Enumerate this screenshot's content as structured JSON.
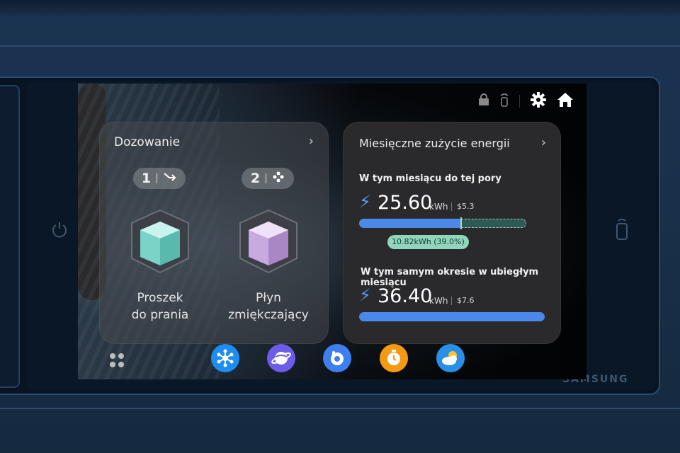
{
  "device": {
    "brand": "SAMSUNG"
  },
  "status_bar": {
    "icons": [
      "lock-icon",
      "remote-control-icon",
      "settings-icon",
      "home-icon"
    ]
  },
  "dosing_card": {
    "title": "Dozowanie",
    "slots": [
      {
        "number": "1",
        "icon": "arrow-detergent-icon",
        "label_line1": "Proszek",
        "label_line2": "do prania",
        "color": "#8fe0d4"
      },
      {
        "number": "2",
        "icon": "flower-softener-icon",
        "label_line1": "Płyn",
        "label_line2": "zmiękczający",
        "color": "#d6bde8"
      }
    ]
  },
  "energy_card": {
    "title": "Miesięczne zużycie energii",
    "current": {
      "label": "W tym miesiącu do tej pory",
      "value": "25.60",
      "unit": "kWh",
      "cost": "$5.3",
      "difference_label": "10.82kWh (39.0%)",
      "fraction": 0.61
    },
    "previous": {
      "label": "W tym samym okresie w ubiegłym miesiącu",
      "value": "36.40",
      "unit": "kWh",
      "cost": "$7.6",
      "fraction": 1.0
    },
    "accent_color": "#4b89e8"
  },
  "dock": {
    "apps": [
      {
        "name": "smartthings-icon",
        "color": "#1e8cf0"
      },
      {
        "name": "internet-browser-icon",
        "color": "#6c5ce7"
      },
      {
        "name": "bixby-icon",
        "color": "#3d7ff0"
      },
      {
        "name": "alarm-clock-icon",
        "color": "#f29a12"
      },
      {
        "name": "weather-icon",
        "color": "#2a8fe6"
      }
    ]
  }
}
